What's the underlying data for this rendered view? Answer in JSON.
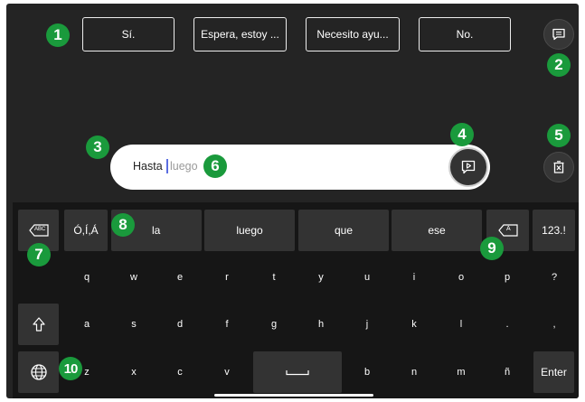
{
  "phrases": [
    "Sí.",
    "Espera, estoy ...",
    "Necesito ayu...",
    "No."
  ],
  "input": {
    "typed": "Hasta",
    "suggestion": "luego"
  },
  "word_suggestions": [
    "la",
    "luego",
    "que",
    "ese"
  ],
  "keys": {
    "accent_key": "Ó,Í,Á",
    "numbers_key": "123.!",
    "enter_key": "Enter",
    "row1": [
      "q",
      "w",
      "e",
      "r",
      "t",
      "y",
      "u",
      "i",
      "o",
      "p",
      "?"
    ],
    "row2": [
      "a",
      "s",
      "d",
      "f",
      "g",
      "h",
      "j",
      "k",
      "l",
      ".",
      ","
    ],
    "row3_left": [
      "z",
      "x",
      "c",
      "v"
    ],
    "row3_right": [
      "b",
      "n",
      "m",
      "ñ"
    ],
    "abc_backspace_label": "ABC",
    "backspace_label": "A"
  },
  "callouts": [
    "1",
    "2",
    "3",
    "4",
    "5",
    "6",
    "7",
    "8",
    "9",
    "10"
  ],
  "icons": {
    "phrases_icon": "chat-bubble-icon",
    "speak_icon": "speak-play-icon",
    "clear_icon": "clear-text-icon",
    "shift_icon": "shift-arrow-icon",
    "globe_icon": "globe-icon",
    "space_icon": "space-bar-icon"
  },
  "colors": {
    "badge": "#1a9a3c",
    "caret": "#5b6ee1",
    "background": "#242424",
    "keyboard": "#161616"
  }
}
